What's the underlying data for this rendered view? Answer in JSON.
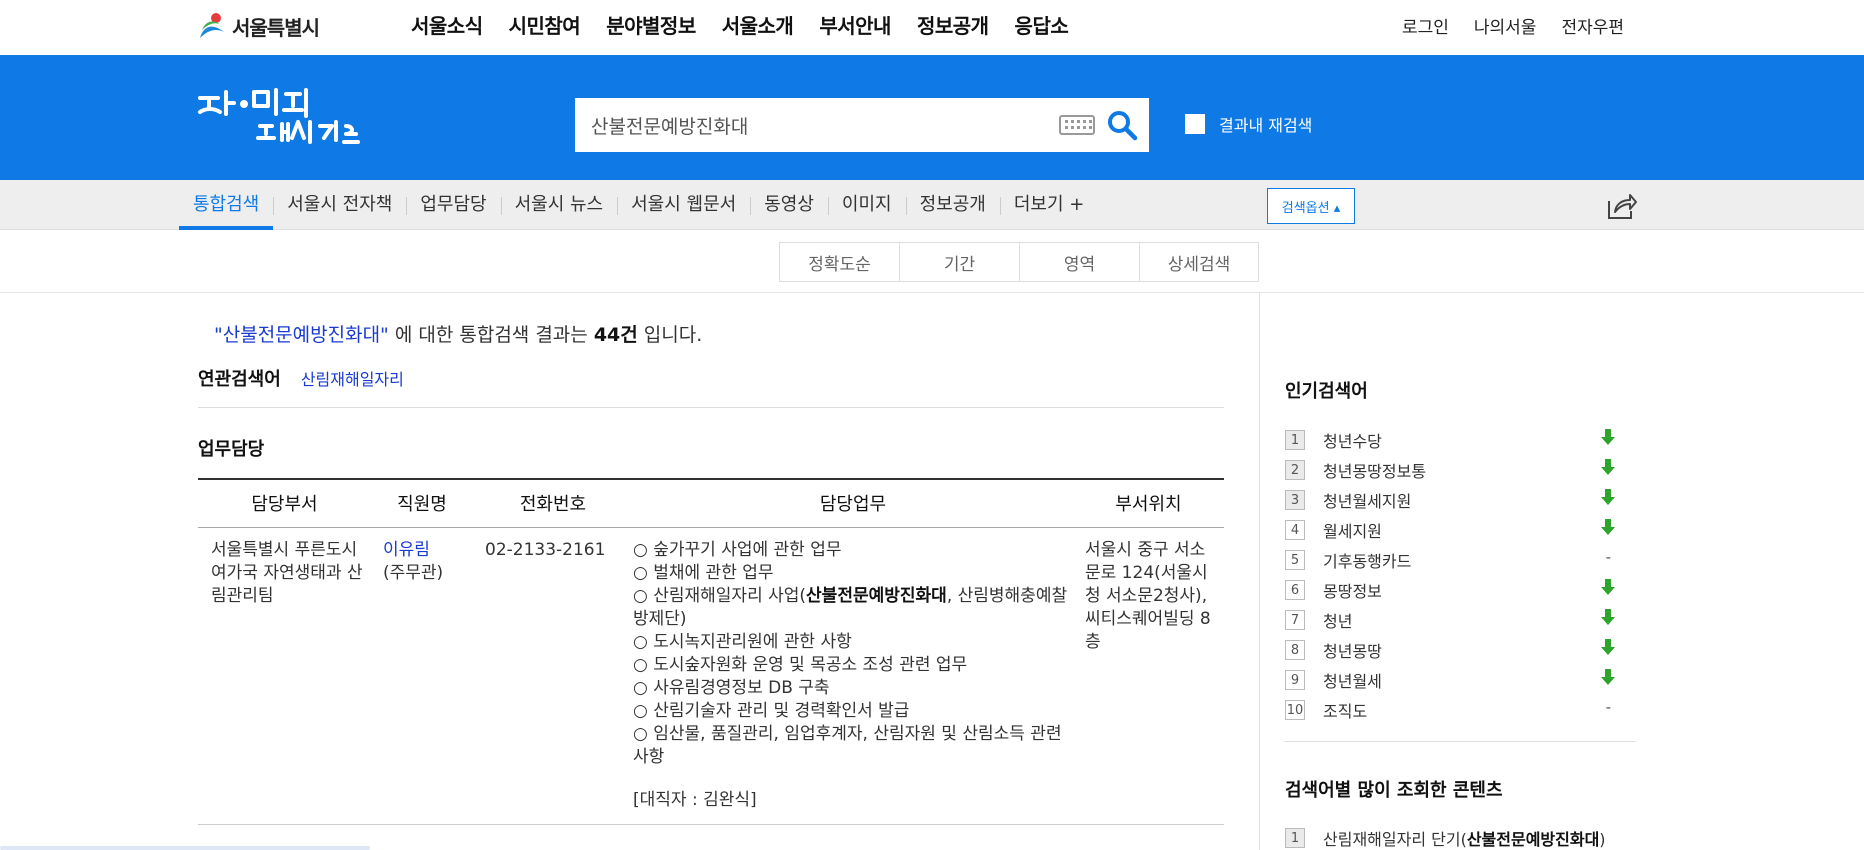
{
  "gnb": {
    "logo_text": "서울특별시",
    "menu": [
      "서울소식",
      "시민참여",
      "분야별정보",
      "서울소개",
      "부서안내",
      "정보공개",
      "응답소"
    ],
    "util": [
      "로그인",
      "나의서울",
      "전자우편"
    ]
  },
  "band": {
    "search_value": "산불전문예방진화대",
    "rescan_label": "결과내 재검색"
  },
  "tabs": {
    "items": [
      "통합검색",
      "서울시 전자책",
      "업무담당",
      "서울시 뉴스",
      "서울시 웹문서",
      "동영상",
      "이미지",
      "정보공개",
      "더보기 +"
    ],
    "active": "통합검색",
    "option_label": "검색옵션 ▴"
  },
  "sort": [
    "정확도순",
    "기간",
    "영역",
    "상세검색"
  ],
  "summary": {
    "query": "\"산불전문예방진화대\"",
    "middle": " 에 대한 통합검색 결과는 ",
    "count": "44건",
    "tail": " 입니다."
  },
  "related": {
    "heading": "연관검색어",
    "items": [
      "산림재해일자리"
    ]
  },
  "section": {
    "title": "업무담당",
    "headers": [
      "담당부서",
      "직원명",
      "전화번호",
      "담당업무",
      "부서위치"
    ],
    "row": {
      "dept": "서울특별시 푸른도시여가국 자연생태과 산림관리팀",
      "name": "이유림",
      "rank": "(주무관)",
      "tel": "02-2133-2161",
      "tasks": [
        "○ 숲가꾸기 사업에 관한 업무",
        "○ 벌채에 관한 업무",
        "○ 산림재해일자리 사업(",
        "○ 도시녹지관리원에 관한 사항",
        "○ 도시숲자원화 운영 및 목공소 조성 관련 업무",
        "○ 사유림경영정보 DB 구축",
        "○ 산림기술자 관리 및 경력확인서 발급",
        "○ 임산물, 품질관리, 임업후계자, 산림자원 및 산림소득 관련 사항"
      ],
      "task3_bold": "산불전문예방진화대",
      "task3_tail": ", 산림병해충예찰방제단)",
      "substitute": "[대직자 : 김완식]",
      "location": "서울시 중구 서소문로 124(서울시청 서소문2청사), 씨티스퀘어빌딩 8층"
    }
  },
  "popular": {
    "title": "인기검색어",
    "items": [
      {
        "rank": "1",
        "term": "청년수당",
        "trend": "down"
      },
      {
        "rank": "2",
        "term": "청년몽땅정보통",
        "trend": "down"
      },
      {
        "rank": "3",
        "term": "청년월세지원",
        "trend": "down"
      },
      {
        "rank": "4",
        "term": "월세지원",
        "trend": "down"
      },
      {
        "rank": "5",
        "term": "기후동행카드",
        "trend": "same"
      },
      {
        "rank": "6",
        "term": "몽땅정보",
        "trend": "down"
      },
      {
        "rank": "7",
        "term": "청년",
        "trend": "down"
      },
      {
        "rank": "8",
        "term": "청년몽땅",
        "trend": "down"
      },
      {
        "rank": "9",
        "term": "청년월세",
        "trend": "down"
      },
      {
        "rank": "10",
        "term": "조직도",
        "trend": "same"
      }
    ],
    "same_mark": "-"
  },
  "hot": {
    "title": "검색어별 많이 조회한 콘텐츠",
    "items": [
      {
        "rank": "1",
        "text": "산림재해일자리 단기(",
        "bold": "산불전문예방진화대",
        "tail": ")"
      }
    ]
  },
  "colors": {
    "brand_blue": "#0f7ae5",
    "link_blue": "#1a3bd1",
    "trend_green": "#2ca52c"
  }
}
